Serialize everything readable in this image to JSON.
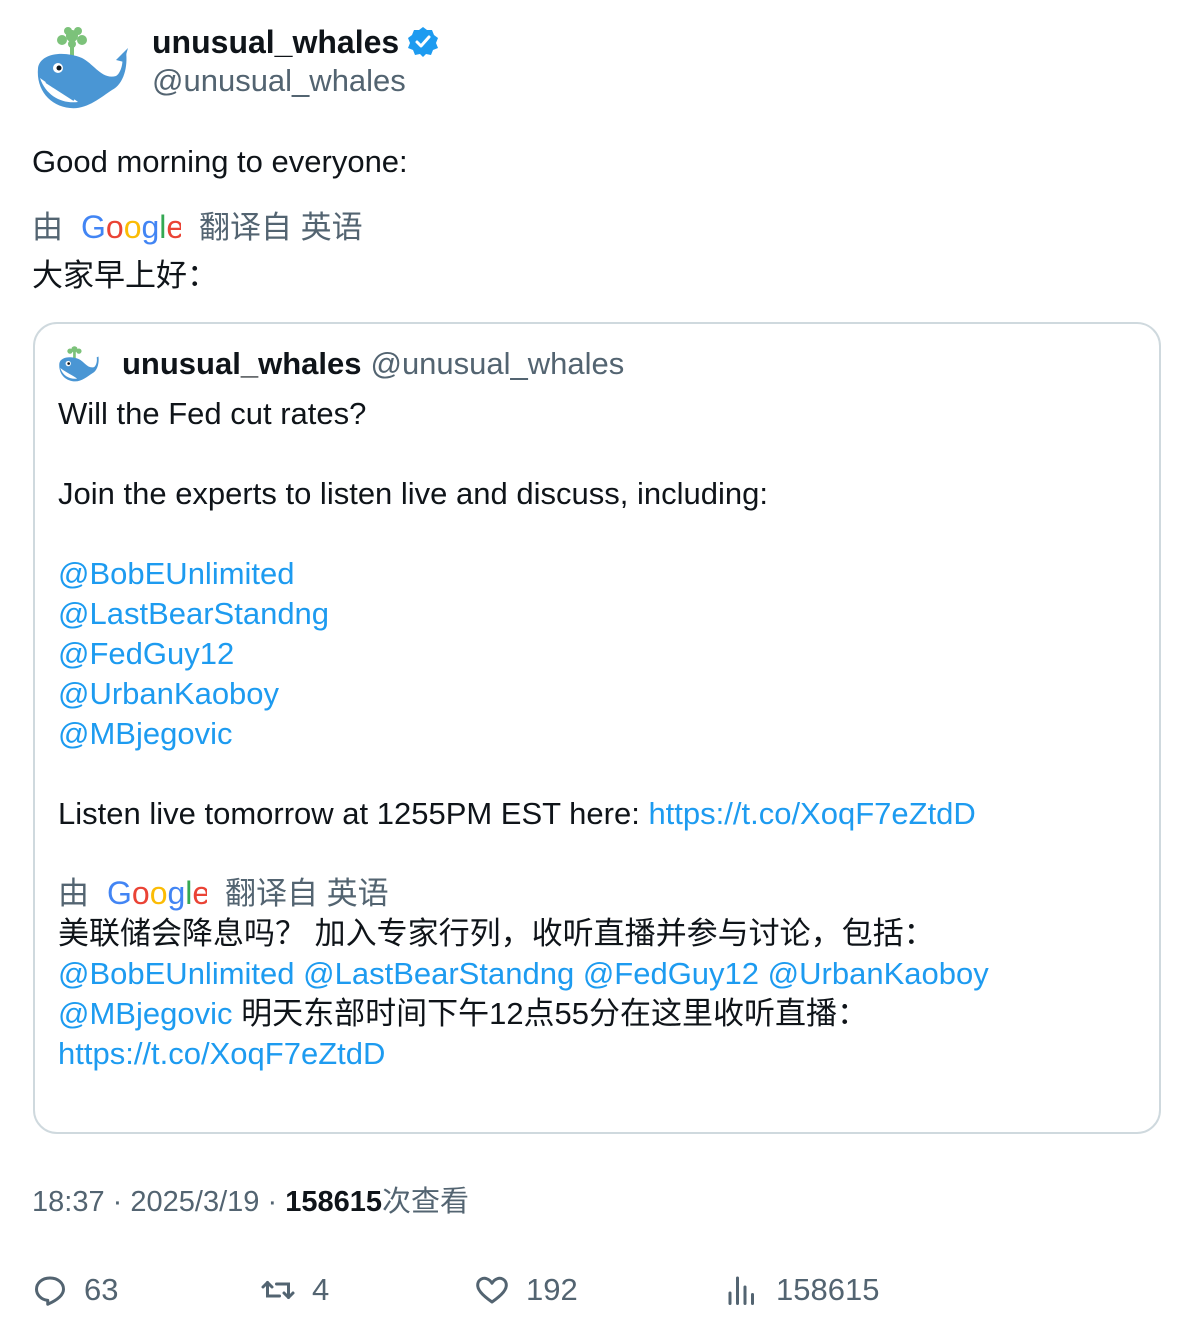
{
  "author": {
    "display_name": "unusual_whales",
    "handle": "@unusual_whales",
    "verified": true,
    "verified_icon": "verified-badge-icon",
    "avatar_icon": "whale-avatar-icon"
  },
  "tweet": {
    "text": "Good morning to everyone:",
    "translation": {
      "prefix": "由",
      "provider": "Google",
      "suffix": "翻译自 英语",
      "text": "大家早上好："
    }
  },
  "quote": {
    "display_name": "unusual_whales",
    "handle": "@unusual_whales",
    "line1": "Will the Fed cut rates?",
    "line2": "Join the experts to listen live and discuss, including:",
    "mentions": [
      "@BobEUnlimited",
      "@LastBearStandng",
      "@FedGuy12",
      "@UrbanKaoboy",
      "@MBjegovic"
    ],
    "listen_text": "Listen live tomorrow at 1255PM EST here: ",
    "link": "https://t.co/XoqF7eZtdD",
    "translation": {
      "prefix": "由",
      "provider": "Google",
      "suffix": "翻译自 英语",
      "line1": "美联储会降息吗？ 加入专家行列，收听直播并参与讨论，包括：",
      "line3_text": " 明天东部时间下午12点55分在这里收听直播：",
      "link": "https://t.co/XoqF7eZtdD"
    }
  },
  "meta": {
    "time": "18:37",
    "sep": "·",
    "date": "2025/3/19",
    "views": "158615",
    "views_label": "次查看"
  },
  "actions": {
    "replies": "63",
    "retweets": "4",
    "likes": "192",
    "views": "158615"
  },
  "colors": {
    "link": "#1d9bf0",
    "muted": "#536471",
    "text": "#0f1419",
    "border": "#cfd9de"
  }
}
